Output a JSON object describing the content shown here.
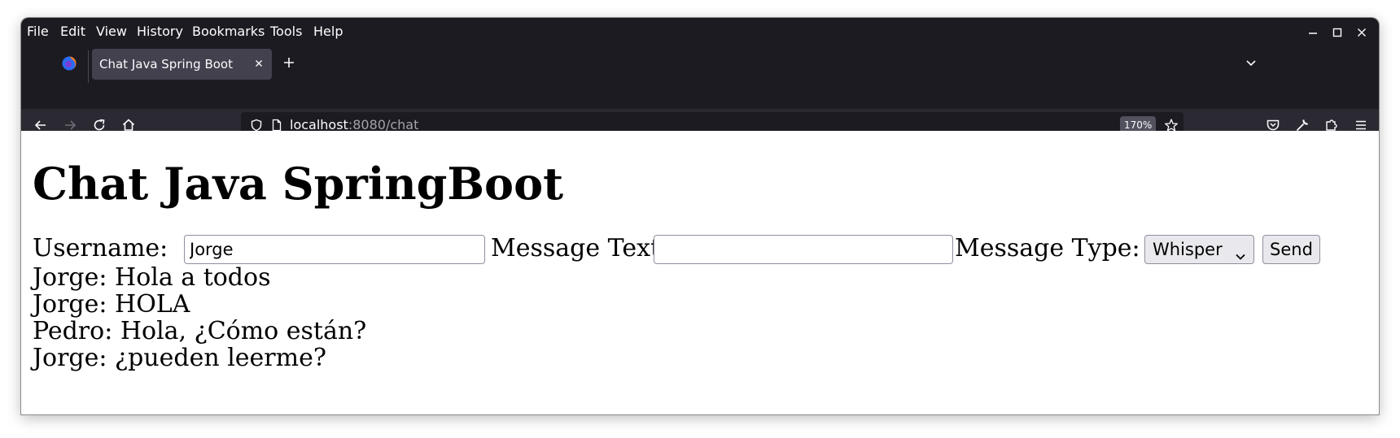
{
  "browser": {
    "menu": [
      "File",
      "Edit",
      "View",
      "History",
      "Bookmarks",
      "Tools",
      "Help"
    ],
    "tab": {
      "title": "Chat Java Spring Boot"
    },
    "url": {
      "host": "localhost",
      "path": ":8080/chat"
    },
    "zoom": "170%"
  },
  "page": {
    "title": "Chat Java SpringBoot",
    "form": {
      "username_label": "Username:",
      "username_value": "Jorge",
      "message_label": "Message Text:",
      "message_value": "",
      "type_label": "Message Type:",
      "type_selected": "Whisper",
      "send_label": "Send"
    },
    "messages": [
      "Jorge: Hola a todos",
      "Jorge: HOLA",
      "Pedro: Hola, ¿Cómo están?",
      "Jorge: ¿pueden leerme?"
    ]
  }
}
